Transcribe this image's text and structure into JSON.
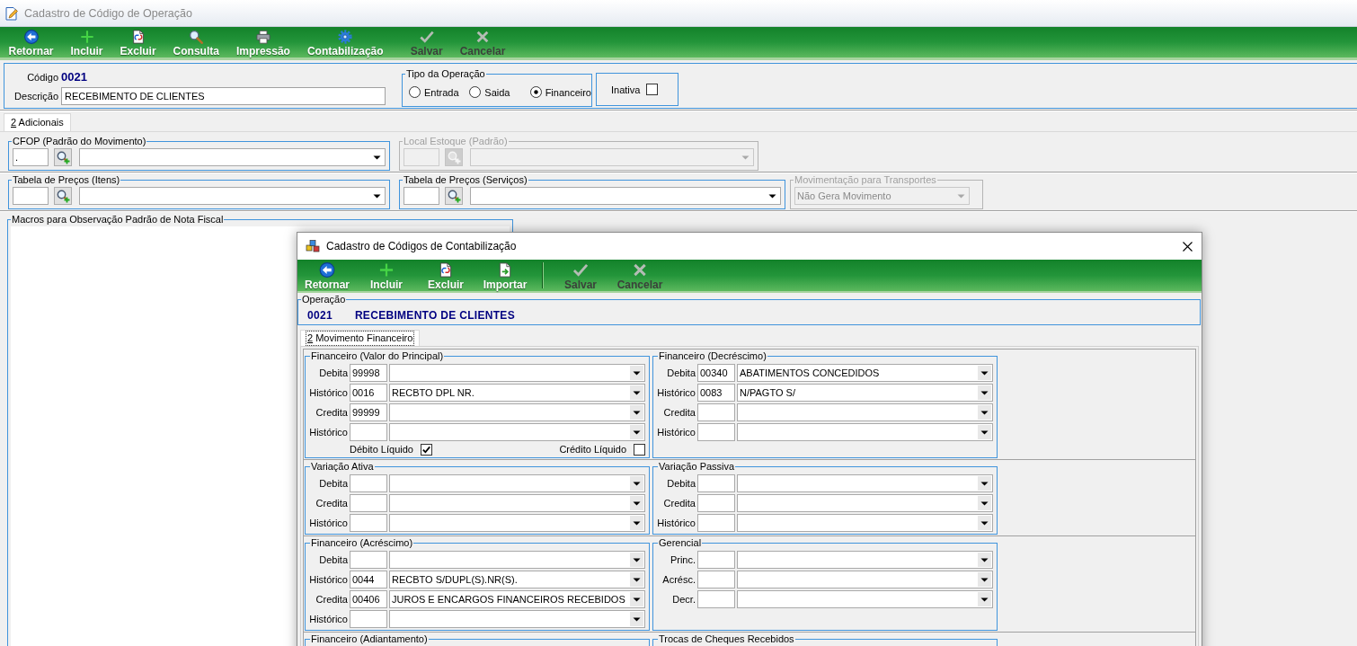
{
  "window": {
    "title": "Cadastro de Código de Operação",
    "active": false
  },
  "toolbar": {
    "separator": false,
    "groups": [
      [
        {
          "kind": "return",
          "label": "Retornar",
          "disabled": false
        },
        {
          "kind": "add",
          "label": "Incluir",
          "disabled": false
        },
        {
          "kind": "delete",
          "label": "Excluir",
          "disabled": false
        },
        {
          "kind": "search",
          "label": "Consulta",
          "disabled": false
        },
        {
          "kind": "print",
          "label": "Impressão",
          "disabled": false
        },
        {
          "kind": "accounting",
          "label": "Contabilização",
          "disabled": false
        }
      ],
      [
        {
          "kind": "save",
          "label": "Salvar",
          "disabled": true
        },
        {
          "kind": "cancel",
          "label": "Cancelar",
          "disabled": true
        }
      ]
    ]
  },
  "header": {
    "code_label": "Código",
    "code": "0021",
    "description_label": "Descrição",
    "description": "RECEBIMENTO DE CLIENTES",
    "operation_type": {
      "legend": "Tipo da Operação",
      "options": [
        {
          "label": "Entrada",
          "selected": false
        },
        {
          "label": "Saida",
          "selected": false
        },
        {
          "label": "Financeiro",
          "selected": true
        }
      ]
    },
    "inactive": {
      "label": "Inativa",
      "checked": false
    }
  },
  "tabs": [
    {
      "label": "2 Adicionais",
      "selected": true
    }
  ],
  "tab_page": {
    "rows": [
      [
        {
          "kind": "lookup",
          "legend": "CFOP (Padrão do Movimento)",
          "disabled": false,
          "code": "."
        },
        {
          "kind": "lookup",
          "legend": "Local Estoque (Padrão)",
          "disabled": true
        }
      ],
      [
        {
          "kind": "lookup",
          "legend": "Tabela de Preços (Itens)",
          "disabled": false
        },
        {
          "kind": "lookup",
          "legend": "Tabela de Preços (Serviços)",
          "disabled": false
        },
        {
          "kind": "combo",
          "legend": "Movimentação para Transportes",
          "disabled": true,
          "value": "Não Gera Movimento"
        }
      ]
    ],
    "memo": {
      "legend": "Macros para Observação Padrão de Nota Fiscal"
    }
  },
  "dialog": {
    "title": "Cadastro de Códigos de Contabilização",
    "active": true,
    "toolbar": {
      "separator": true,
      "groups": [
        [
          {
            "kind": "return",
            "label": "Retornar",
            "disabled": false
          },
          {
            "kind": "add",
            "label": "Incluir",
            "disabled": false
          },
          {
            "kind": "delete",
            "label": "Excluir",
            "disabled": false
          },
          {
            "kind": "import",
            "label": "Importar",
            "disabled": false
          }
        ],
        [
          {
            "kind": "save",
            "label": "Salvar",
            "disabled": true
          },
          {
            "kind": "cancel",
            "label": "Cancelar",
            "disabled": true
          }
        ]
      ]
    },
    "operation": {
      "legend": "Operação",
      "code": "0021",
      "description": "RECEBIMENTO DE CLIENTES"
    },
    "tabs": [
      {
        "label": "2 Movimento Financeiro",
        "selected": true,
        "focused": true
      }
    ],
    "section_rows": [
      [
        {
          "legend": "Financeiro (Valor do Principal)",
          "fields": [
            {
              "label": "Debita",
              "code": "99998"
            },
            {
              "label": "Histórico",
              "code": "0016",
              "value": "RECBTO DPL NR."
            },
            {
              "label": "Credita",
              "code": "99999"
            },
            {
              "label": "Histórico"
            }
          ],
          "checks": [
            {
              "label": "Débito Líquido",
              "checked": true
            },
            {
              "label": "Crédito Líquido",
              "checked": false
            }
          ]
        },
        {
          "legend": "Financeiro (Decréscimo)",
          "fields": [
            {
              "label": "Debita",
              "code": "00340",
              "value": "ABATIMENTOS CONCEDIDOS"
            },
            {
              "label": "Histórico",
              "code": "0083",
              "value": "N/PAGTO S/"
            },
            {
              "label": "Credita"
            },
            {
              "label": "Histórico"
            }
          ]
        }
      ],
      [
        {
          "legend": "Variação Ativa",
          "fields": [
            {
              "label": "Debita"
            },
            {
              "label": "Credita"
            },
            {
              "label": "Histórico"
            }
          ]
        },
        {
          "legend": "Variação Passiva",
          "fields": [
            {
              "label": "Debita"
            },
            {
              "label": "Credita"
            },
            {
              "label": "Histórico"
            }
          ]
        }
      ],
      [
        {
          "legend": "Financeiro (Acréscimo)",
          "fields": [
            {
              "label": "Debita"
            },
            {
              "label": "Histórico",
              "code": "0044",
              "value": "RECBTO S/DUPL(S).NR(S)."
            },
            {
              "label": "Credita",
              "code": "00406",
              "value": "JUROS E ENCARGOS FINANCEIROS RECEBIDOS"
            },
            {
              "label": "Histórico"
            }
          ]
        },
        {
          "legend": "Gerencial",
          "fields": [
            {
              "label": "Princ."
            },
            {
              "label": "Acrésc."
            },
            {
              "label": "Decr."
            }
          ]
        }
      ],
      [
        {
          "legend": "Financeiro (Adiantamento)"
        },
        {
          "legend": "Trocas de Cheques Recebidos"
        }
      ]
    ]
  }
}
